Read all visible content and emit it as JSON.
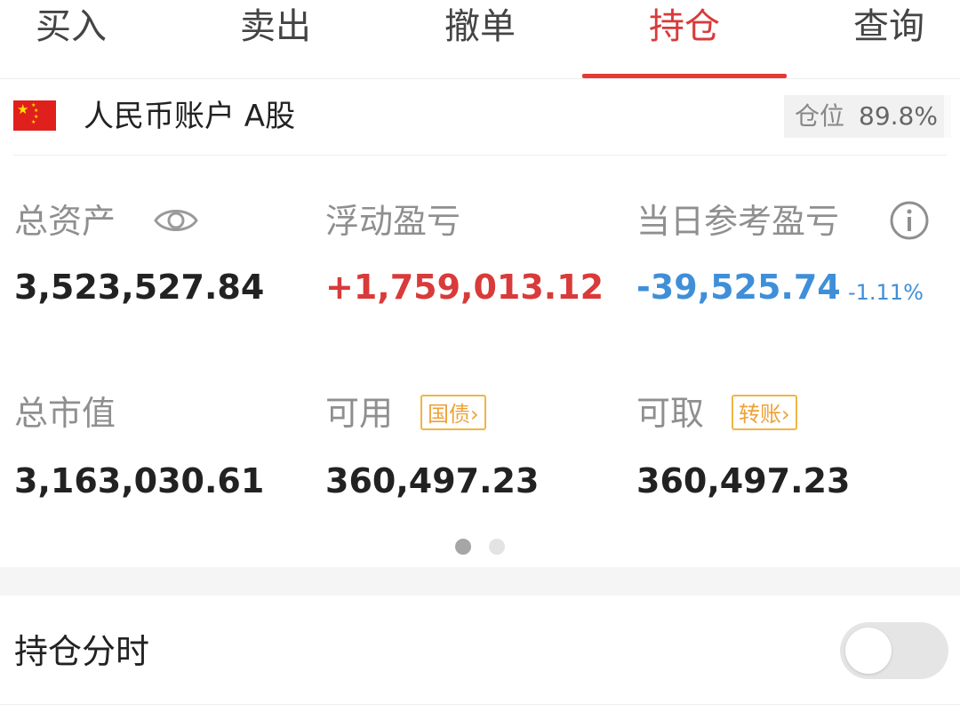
{
  "tabs": [
    {
      "label": "买入",
      "active": false
    },
    {
      "label": "卖出",
      "active": false
    },
    {
      "label": "撤单",
      "active": false
    },
    {
      "label": "持仓",
      "active": true
    },
    {
      "label": "查询",
      "active": false
    }
  ],
  "account": {
    "flag_icon": "china-flag-icon",
    "name": "人民币账户 A股",
    "position_label": "仓位",
    "position_value": "89.8%"
  },
  "stats": {
    "total_assets": {
      "label": "总资产",
      "value": "3,523,527.84",
      "icon": "eye-icon"
    },
    "floating_pnl": {
      "label": "浮动盈亏",
      "value": "+1,759,013.12",
      "color": "#d93a3a"
    },
    "daily_pnl": {
      "label": "当日参考盈亏",
      "value": "-39,525.74",
      "percent": "-1.11%",
      "color": "#3f8fd8",
      "icon": "info-icon"
    },
    "market_value": {
      "label": "总市值",
      "value": "3,163,030.61"
    },
    "available": {
      "label": "可用",
      "value": "360,497.23",
      "tag": "国债"
    },
    "withdrawable": {
      "label": "可取",
      "value": "360,497.23",
      "tag": "转账"
    }
  },
  "pager": {
    "count": 2,
    "active_index": 0
  },
  "holding_timeshare": {
    "label": "持仓分时",
    "enabled": false
  },
  "colors": {
    "accent": "#e53935",
    "tag": "#eda236"
  }
}
